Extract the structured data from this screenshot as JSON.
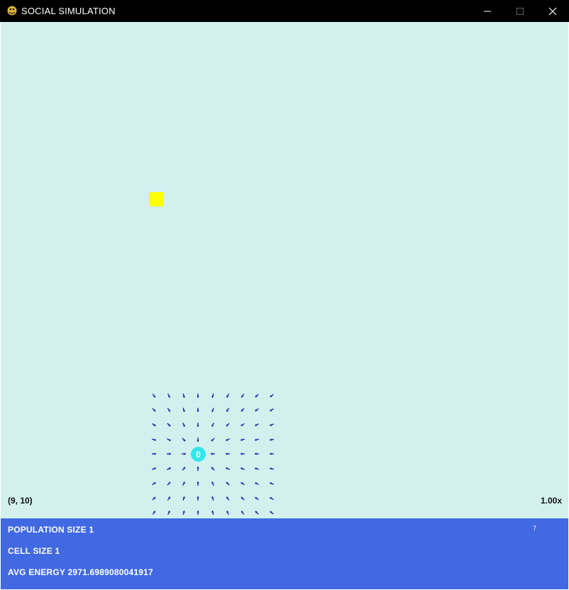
{
  "window": {
    "title": "SOCIAL SIMULATION",
    "icon": "pygame-snake-icon"
  },
  "colors": {
    "canvas_bg": "#d3f0ee",
    "food": "#ffff00",
    "agent": "#33e6ea",
    "arrow": "#1a1aa8",
    "stats_bg": "#4169e1",
    "titlebar_bg": "#000000"
  },
  "simulation": {
    "agent_label": "0",
    "coords": "(9, 10)",
    "zoom": "1.00x"
  },
  "stats": {
    "population": "POPULATION SIZE 1",
    "cell_size": "CELL SIZE 1",
    "avg_energy": "AVG ENERGY 2971.6989080041917",
    "fps": "7"
  }
}
